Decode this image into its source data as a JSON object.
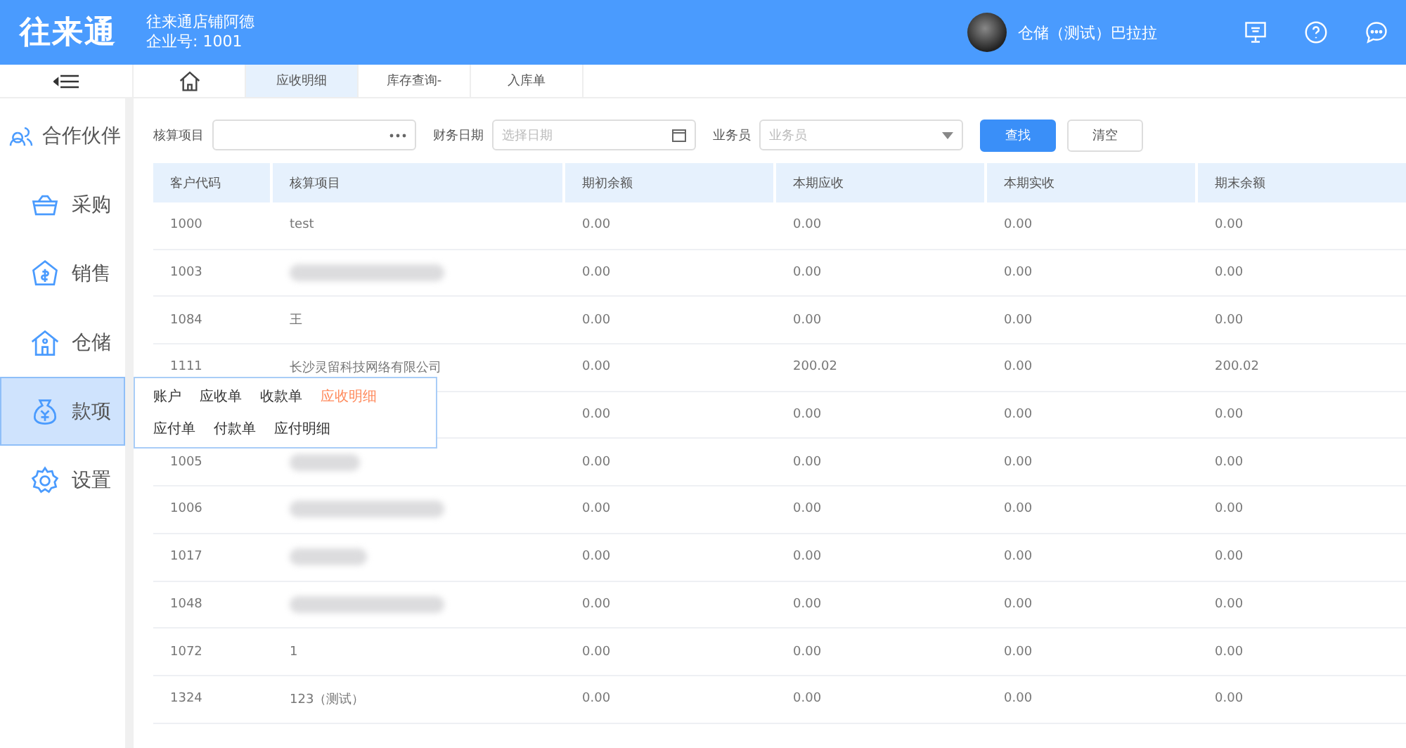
{
  "header": {
    "logo": "往来通",
    "store": "往来通店铺阿德",
    "company": "企业号: 1001",
    "user": "仓储（测试）巴拉拉"
  },
  "tabs": [
    {
      "kind": "home",
      "selected": false
    },
    {
      "kind": "text",
      "label": "应收明细",
      "selected": true
    },
    {
      "kind": "text",
      "label": "库存查询-",
      "selected": false
    },
    {
      "kind": "text",
      "label": "入库单",
      "selected": false
    }
  ],
  "sidebar": {
    "items": [
      {
        "label": "合作伙伴",
        "selected": false
      },
      {
        "label": "采购",
        "selected": false
      },
      {
        "label": "销售",
        "selected": false
      },
      {
        "label": "仓储",
        "selected": false
      },
      {
        "label": "款项",
        "selected": true
      },
      {
        "label": "设置",
        "selected": false
      }
    ]
  },
  "submenu": [
    [
      {
        "label": "账户",
        "selected": false
      },
      {
        "label": "应收单",
        "selected": false
      },
      {
        "label": "收款单",
        "selected": false
      },
      {
        "label": "应收明细",
        "selected": true
      }
    ],
    [
      {
        "label": "应付单",
        "selected": false
      },
      {
        "label": "付款单",
        "selected": false
      },
      {
        "label": "应付明细",
        "selected": false
      }
    ]
  ],
  "filters": {
    "item_label": "核算项目",
    "date_label": "财务日期",
    "date_placeholder": "选择日期",
    "staff_label": "业务员",
    "staff_placeholder": "业务员",
    "search": "查找",
    "clear": "清空"
  },
  "table": {
    "columns": [
      "客户代码",
      "核算项目",
      "期初余额",
      "本期应收",
      "本期实收",
      "期末余额"
    ],
    "rows": [
      {
        "cells": [
          "1000",
          "test",
          "0.00",
          "0.00",
          "0.00",
          "0.00"
        ],
        "redacted": false
      },
      {
        "cells": [
          "1003",
          "",
          "0.00",
          "0.00",
          "0.00",
          "0.00"
        ],
        "redacted": true
      },
      {
        "cells": [
          "1084",
          "王",
          "0.00",
          "0.00",
          "0.00",
          "0.00"
        ],
        "redacted": false
      },
      {
        "cells": [
          "1111",
          "长沙灵留科技网络有限公司",
          "0.00",
          "200.02",
          "0.00",
          "200.02"
        ],
        "redacted": false
      },
      {
        "cells": [
          "",
          "",
          "0.00",
          "0.00",
          "0.00",
          "0.00"
        ]
      },
      {
        "cells": [
          "1005",
          "",
          "0.00",
          "0.00",
          "0.00",
          "0.00"
        ],
        "redacted": true
      },
      {
        "cells": [
          "1006",
          "",
          "0.00",
          "0.00",
          "0.00",
          "0.00"
        ],
        "redacted": true
      },
      {
        "cells": [
          "1017",
          "",
          "0.00",
          "0.00",
          "0.00",
          "0.00"
        ],
        "redacted": true
      },
      {
        "cells": [
          "1048",
          "",
          "0.00",
          "0.00",
          "0.00",
          "0.00"
        ],
        "redacted": true
      },
      {
        "cells": [
          "1072",
          "1",
          "0.00",
          "0.00",
          "0.00",
          "0.00"
        ],
        "redacted": false
      },
      {
        "cells": [
          "1324",
          "123（测试）",
          "0.00",
          "0.00",
          "0.00",
          "0.00"
        ],
        "redacted": false
      }
    ]
  }
}
